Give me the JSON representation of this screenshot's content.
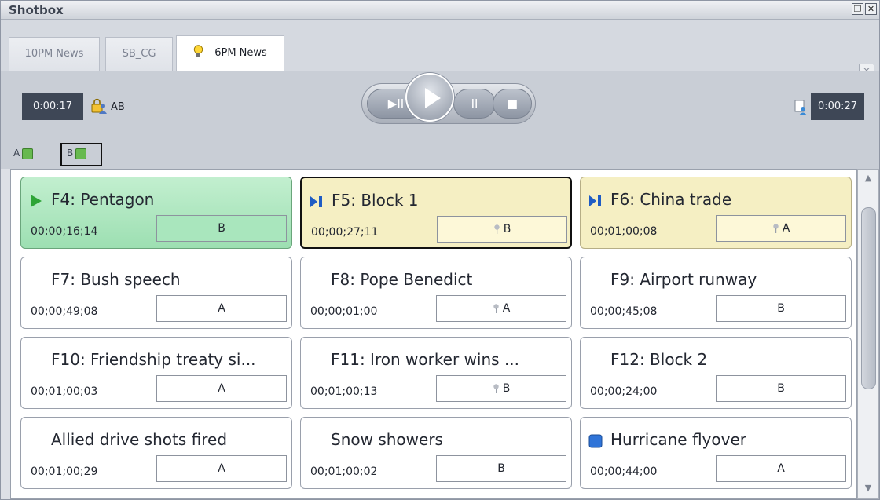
{
  "window": {
    "title": "Shotbox",
    "restore_icon": "restore-icon",
    "close_icon": "close-icon"
  },
  "tabs": [
    {
      "label": "10PM News",
      "active": false
    },
    {
      "label": "SB_CG",
      "active": false
    },
    {
      "label": "6PM News",
      "active": true,
      "icon": "lightbulb-icon"
    }
  ],
  "tab_close": "×",
  "transport": {
    "elapsed": "0:00:17",
    "owner_label": "AB",
    "remaining": "0:00:27",
    "buttons": {
      "play_pause": "▶II",
      "pause": "II",
      "stop": "■"
    }
  },
  "ab_channels": [
    {
      "label": "A"
    },
    {
      "label": "B"
    }
  ],
  "clips": [
    {
      "title": "F4: Pentagon",
      "time": "00;00;16;14",
      "channel": "B",
      "state": "playing",
      "marker": "play-icon",
      "pinned": false
    },
    {
      "title": "F5: Block 1",
      "time": "00;00;27;11",
      "channel": "B",
      "state": "cued-selected",
      "marker": "cue-icon",
      "pinned": true
    },
    {
      "title": "F6: China trade",
      "time": "00;01;00;08",
      "channel": "A",
      "state": "cued",
      "marker": "cue-icon",
      "pinned": true
    },
    {
      "title": "F7: Bush speech",
      "time": "00;00;49;08",
      "channel": "A",
      "state": "idle",
      "pinned": false
    },
    {
      "title": "F8: Pope Benedict",
      "time": "00;00;01;00",
      "channel": "A",
      "state": "idle",
      "pinned": true
    },
    {
      "title": "F9: Airport runway",
      "time": "00;00;45;08",
      "channel": "B",
      "state": "idle",
      "pinned": false
    },
    {
      "title": "F10: Friendship treaty si...",
      "time": "00;01;00;03",
      "channel": "A",
      "state": "idle",
      "pinned": false
    },
    {
      "title": "F11: Iron worker wins ...",
      "time": "00;01;00;13",
      "channel": "B",
      "state": "idle",
      "pinned": true
    },
    {
      "title": "F12: Block 2",
      "time": "00;00;24;00",
      "channel": "B",
      "state": "idle",
      "pinned": false
    },
    {
      "title": "Allied drive shots fired",
      "time": "00;01;00;29",
      "channel": "A",
      "state": "idle",
      "pinned": false
    },
    {
      "title": "Snow showers",
      "time": "00;01;00;02",
      "channel": "B",
      "state": "idle",
      "pinned": false
    },
    {
      "title": "Hurricane flyover",
      "time": "00;00;44;00",
      "channel": "A",
      "state": "idle",
      "marker": "square-icon",
      "pinned": false
    }
  ],
  "colors": {
    "playing": "#9ddfb2",
    "cued": "#f5efc3",
    "panel": "#c9ced6",
    "time_bg": "#3e4756"
  }
}
